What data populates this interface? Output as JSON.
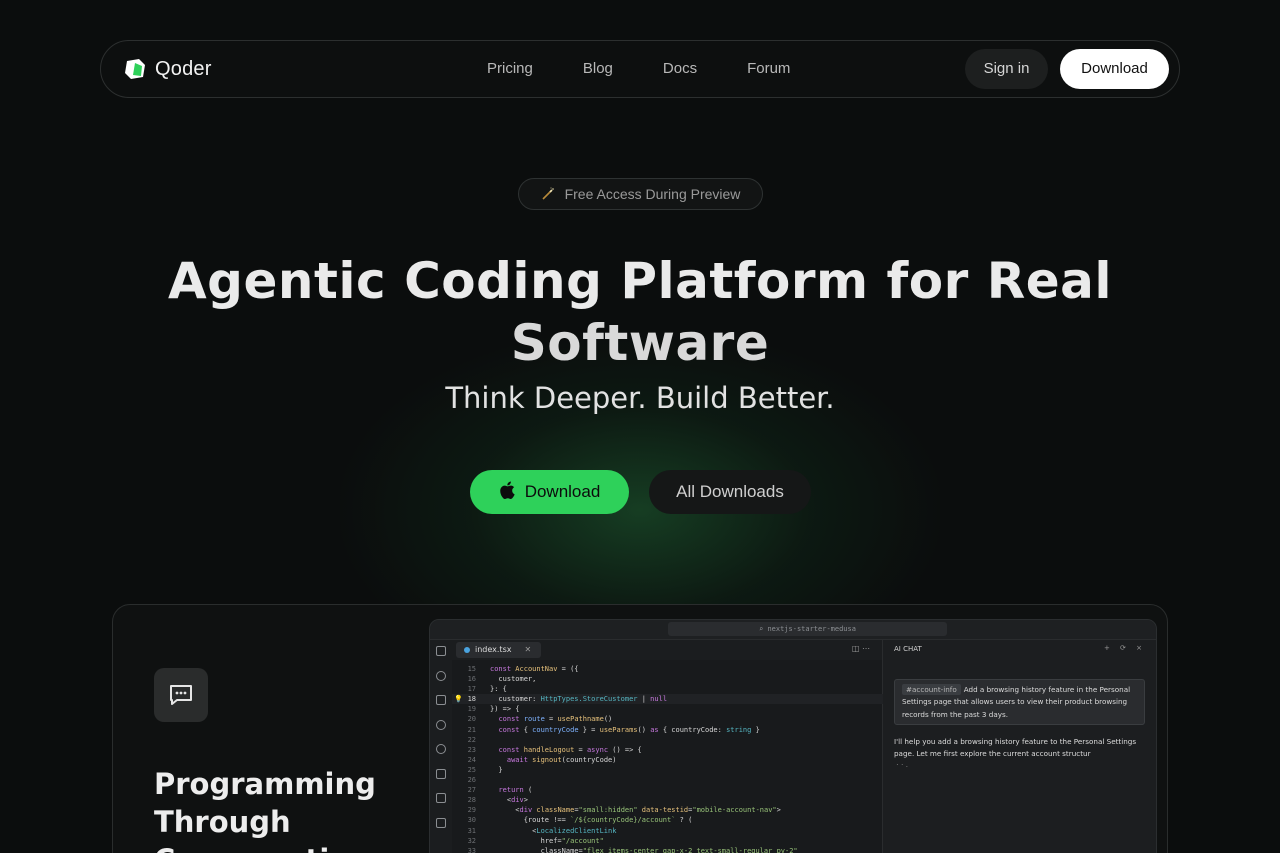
{
  "brand": {
    "name": "Qoder",
    "accent": "#2ed15a"
  },
  "nav": {
    "links": [
      "Pricing",
      "Blog",
      "Docs",
      "Forum"
    ],
    "signin": "Sign in",
    "download": "Download"
  },
  "hero": {
    "badge": "Free Access During Preview",
    "badge_icon": "magic-wand-icon",
    "headline_line1": "Agentic Coding Platform for Real",
    "headline_line2": "Software",
    "subheadline": "Think Deeper. Build Better.",
    "cta_download": "Download",
    "cta_download_icon": "apple-icon",
    "cta_all": "All Downloads"
  },
  "feature": {
    "icon": "chat-bubble-icon",
    "title": "Programming Through Conversation"
  },
  "ide": {
    "search": "nextjs-starter-medusa",
    "tab": "index.tsx",
    "tab_actions": "◫ ⋯",
    "chat_title": "AI CHAT",
    "chat_actions": "+ ⟳ ×",
    "user_context_chip": "#account-info",
    "user_message": "Add a browsing history feature in the Personal Settings page that allows users to view their product browsing records from the past 3 days.",
    "bot_message": "I'll help you add a browsing history feature to the Personal Settings page. Let me first explore the current account structur",
    "typing": "· · ."
  }
}
